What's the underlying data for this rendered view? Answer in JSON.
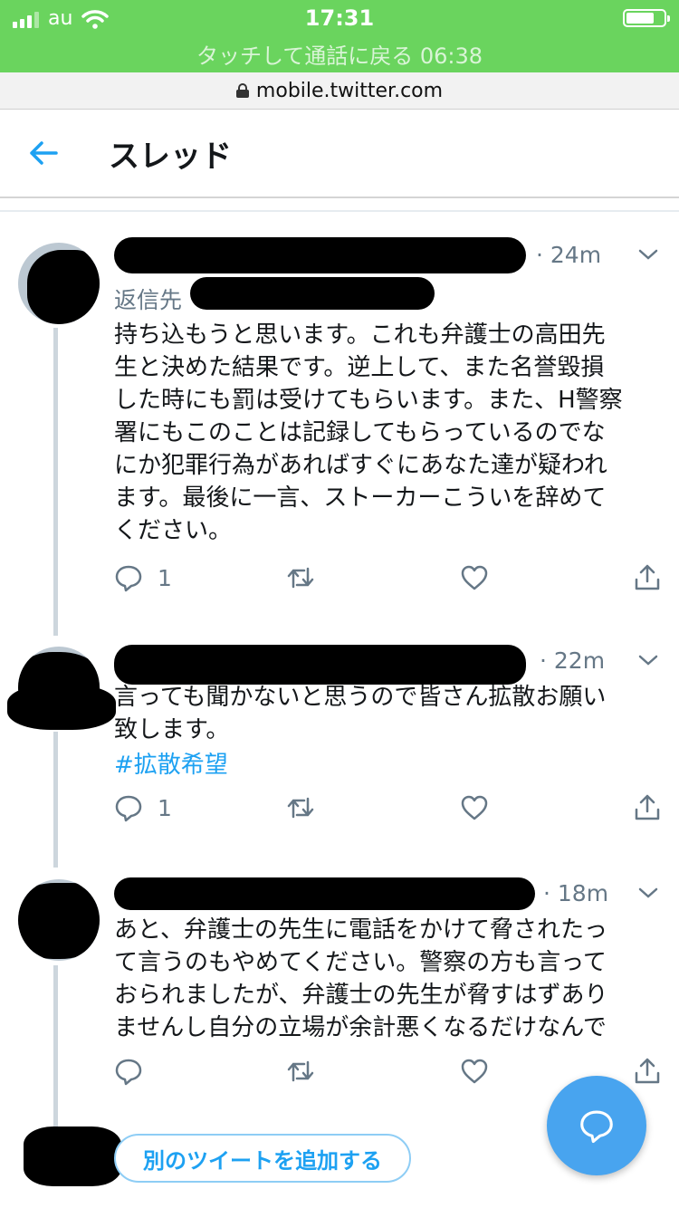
{
  "status_bar": {
    "carrier": "au",
    "time": "17:31",
    "call_banner": "タッチして通話に戻る 06:38"
  },
  "browser": {
    "url": "mobile.twitter.com"
  },
  "header": {
    "title": "スレッド"
  },
  "tweets": [
    {
      "timestamp": "· 24m",
      "reply_prefix": "返信先",
      "text": "持ち込もうと思います。これも弁護士の高田先\n生と決めた結果です。逆上して、また名誉毀損\nした時にも罰は受けてもらいます。また、H警察\n署にもこのことは記録してもらっているのでな\nにか犯罪行為があればすぐにあなた達が疑われ\nます。最後に一言、ストーカーこういを辞めて\nください。",
      "reply_count": "1"
    },
    {
      "timestamp": "· 22m",
      "text": "言っても聞かないと思うので皆さん拡散お願い\n致します。",
      "hashtag": "#拡散希望",
      "reply_count": "1"
    },
    {
      "timestamp": "· 18m",
      "text": "あと、弁護士の先生に電話をかけて脅されたっ\nて言うのもやめてください。警察の方も言って\nおられましたが、弁護士の先生が脅すはずあり\nませんし自分の立場が余計悪くなるだけなんで",
      "reply_count": ""
    }
  ],
  "composer": {
    "add_tweet_label": "別のツイートを追加する"
  },
  "colors": {
    "accent": "#1da1f2",
    "status_green": "#6ad45e",
    "fab": "#48a4ef"
  },
  "icons": [
    "back-arrow-icon",
    "chevron-down-icon",
    "reply-icon",
    "retweet-icon",
    "like-icon",
    "share-icon",
    "compose-icon",
    "lock-icon",
    "wifi-icon",
    "signal-icon",
    "battery-icon"
  ]
}
